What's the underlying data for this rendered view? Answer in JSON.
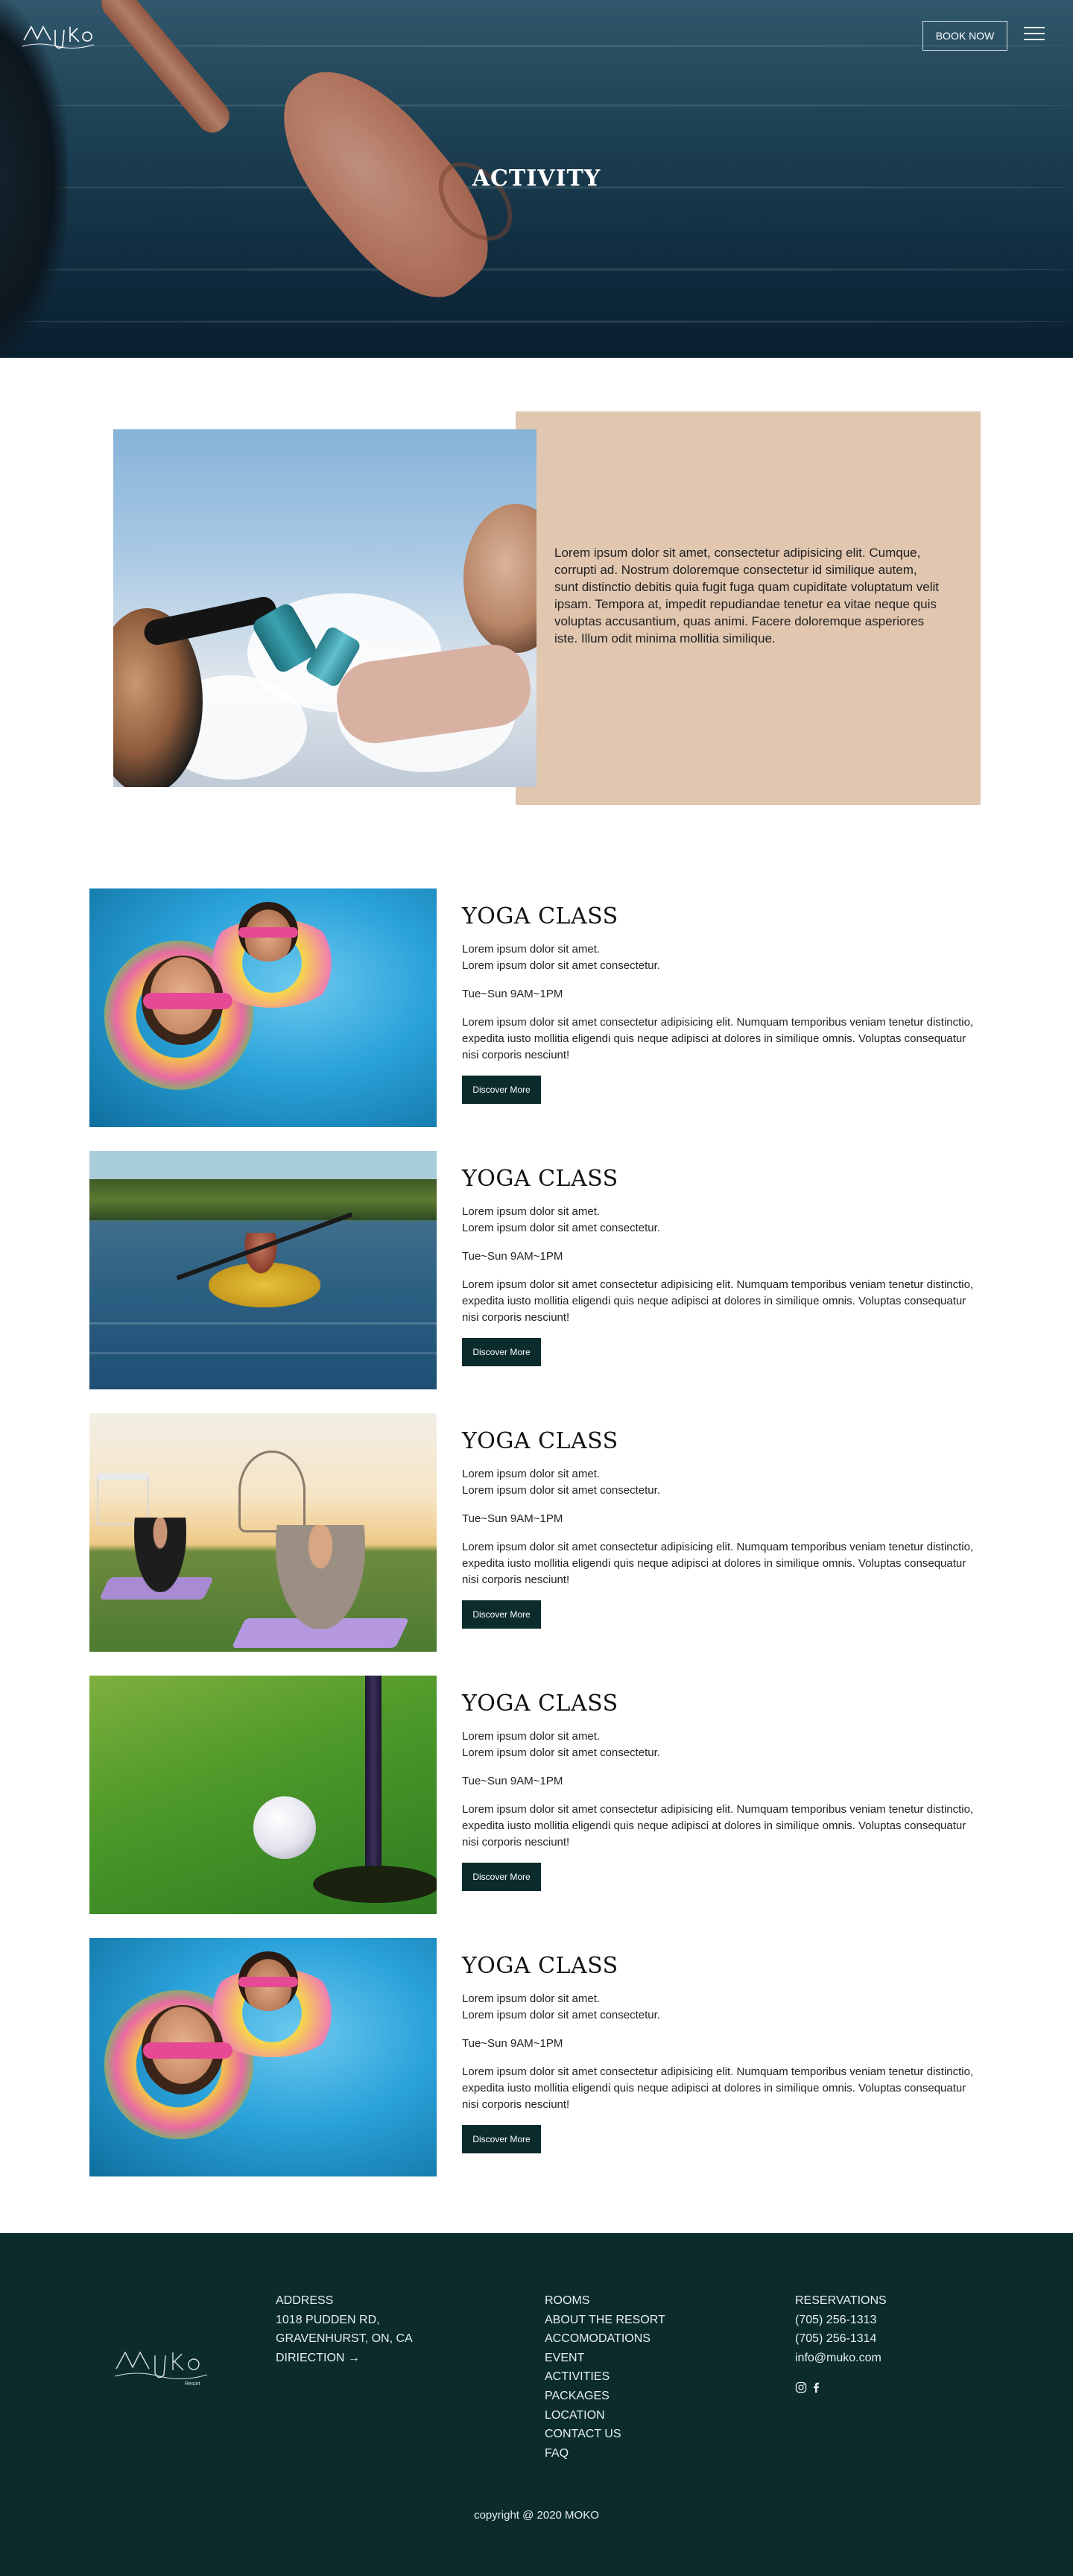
{
  "header": {
    "logo_text": "MuKo",
    "book_now": "BOOK NOW",
    "hero_title": "ACTIVITY"
  },
  "intro": {
    "text": "Lorem ipsum dolor sit amet, consectetur adipisicing elit. Cumque, corrupti ad. Nostrum doloremque consectetur id similique autem, sunt distinctio debitis quia fugit fuga quam cupiditate voluptatum velit ipsam. Tempora at, impedit repudiandae tenetur ea vitae neque quis voluptas accusantium, quas animi. Facere doloremque asperiores iste. Illum odit minima mollitia similique."
  },
  "activities": [
    {
      "title": "YOGA CLASS",
      "line1": "Lorem ipsum dolor sit amet.",
      "line2": "Lorem ipsum dolor sit amet consectetur.",
      "hours": "Tue~Sun 9AM~1PM",
      "description": "Lorem ipsum dolor sit amet consectetur adipisicing elit. Numquam temporibus veniam tenetur distinctio, expedita iusto mollitia eligendi quis neque adipisci at dolores in similique omnis. Voluptas consequatur nisi corporis nesciunt!",
      "button": "Discover More",
      "image": "pool-swimmers"
    },
    {
      "title": "YOGA CLASS",
      "line1": "Lorem ipsum dolor sit amet.",
      "line2": "Lorem ipsum dolor sit amet consectetur.",
      "hours": "Tue~Sun 9AM~1PM",
      "description": "Lorem ipsum dolor sit amet consectetur adipisicing elit. Numquam temporibus veniam tenetur distinctio, expedita iusto mollitia eligendi quis neque adipisci at dolores in similique omnis. Voluptas consequatur nisi corporis nesciunt!",
      "button": "Discover More",
      "image": "kayak-lake"
    },
    {
      "title": "YOGA CLASS",
      "line1": "Lorem ipsum dolor sit amet.",
      "line2": "Lorem ipsum dolor sit amet consectetur.",
      "hours": "Tue~Sun 9AM~1PM",
      "description": "Lorem ipsum dolor sit amet consectetur adipisicing elit. Numquam temporibus veniam tenetur distinctio, expedita iusto mollitia eligendi quis neque adipisci at dolores in similique omnis. Voluptas consequatur nisi corporis nesciunt!",
      "button": "Discover More",
      "image": "outdoor-yoga"
    },
    {
      "title": "YOGA CLASS",
      "line1": "Lorem ipsum dolor sit amet.",
      "line2": "Lorem ipsum dolor sit amet consectetur.",
      "hours": "Tue~Sun 9AM~1PM",
      "description": "Lorem ipsum dolor sit amet consectetur adipisicing elit. Numquam temporibus veniam tenetur distinctio, expedita iusto mollitia eligendi quis neque adipisci at dolores in similique omnis. Voluptas consequatur nisi corporis nesciunt!",
      "button": "Discover More",
      "image": "golf-ball"
    },
    {
      "title": "YOGA CLASS",
      "line1": "Lorem ipsum dolor sit amet.",
      "line2": "Lorem ipsum dolor sit amet consectetur.",
      "hours": "Tue~Sun 9AM~1PM",
      "description": "Lorem ipsum dolor sit amet consectetur adipisicing elit. Numquam temporibus veniam tenetur distinctio, expedita iusto mollitia eligendi quis neque adipisci at dolores in similique omnis. Voluptas consequatur nisi corporis nesciunt!",
      "button": "Discover More",
      "image": "pool-swimmers"
    }
  ],
  "footer": {
    "logo_text": "MuKo",
    "logo_sub": "Resort",
    "address": [
      "ADDRESS",
      "1018 PUDDEN RD,",
      "GRAVENHURST, ON, CA",
      "DIRIECTION →"
    ],
    "links": [
      "ROOMS",
      "ABOUT THE RESORT",
      "ACCOMODATIONS",
      "EVENT",
      "ACTIVITIES",
      "PACKAGES",
      "LOCATION",
      "CONTACT US",
      "FAQ"
    ],
    "contact": [
      "RESERVATIONS",
      "(705) 256-1313",
      "(705) 256-1314",
      "info@muko.com"
    ],
    "social_icons": [
      "instagram-icon",
      "facebook-icon"
    ],
    "copyright": "copyright @ 2020 MOKO"
  },
  "colors": {
    "footer_bg": "#0b2b2c",
    "intro_panel": "#e1c6b0",
    "button_bg": "#0b2b2c"
  }
}
